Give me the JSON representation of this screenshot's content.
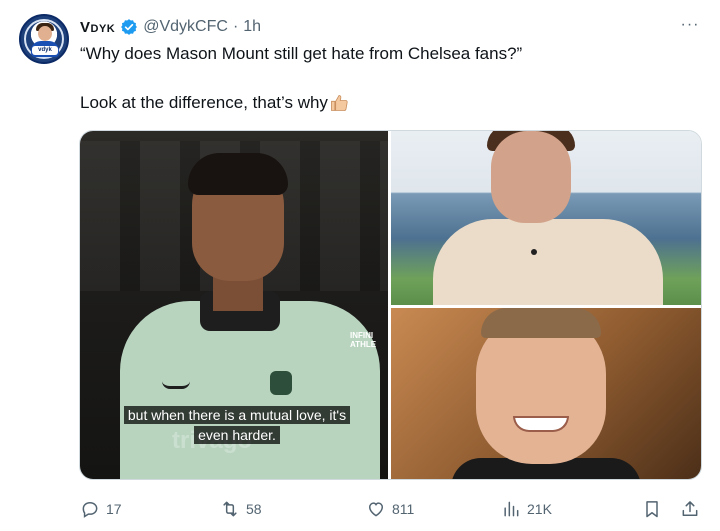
{
  "tweet": {
    "author_name": "Vdyk",
    "handle": "@VdykCFC",
    "separator": "·",
    "time": "1h",
    "more": "···",
    "text_line1": "“Why does Mason Mount still get hate from Chelsea fans?”",
    "text_line2": "Look at the difference, that’s why",
    "avatar_tag": "vdyk"
  },
  "media": {
    "left_image": {
      "caption_line1": "but when there is a mutual love, it's",
      "caption_line2": "even harder.",
      "watermark": "trivago",
      "brand_text": "INFINI ATHLE"
    }
  },
  "actions": {
    "replies": "17",
    "reposts": "58",
    "likes": "811",
    "views": "21K"
  },
  "colors": {
    "verified": "#1d9bf0",
    "secondary_text": "#536471",
    "primary_text": "#0f1419",
    "border": "#cfd9de"
  },
  "icons": [
    "verified-badge-icon",
    "more-icon",
    "thumbs-up-emoji",
    "reply-icon",
    "repost-icon",
    "like-icon",
    "views-icon",
    "bookmark-icon",
    "share-icon"
  ]
}
